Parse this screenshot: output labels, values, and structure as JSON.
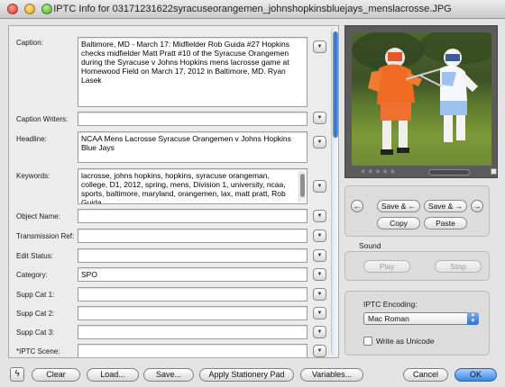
{
  "window": {
    "title": "IPTC Info for 03171231622syracuseorangemen_johnshopkinsbluejays_menslacrosse.JPG"
  },
  "fields": {
    "caption": {
      "label": "Caption:",
      "value": "Baltimore, MD - March 17: Midfielder Rob Guida #27 Hopkins checks midfielder Matt Pratt #10 of the Syracuse Orangemen during the Syracuse v Johns Hopkins mens lacrosse game at  Homewood Field on March 17, 2012 in Baltimore, MD. Ryan Lasek"
    },
    "caption_writers": {
      "label": "Caption Writers:",
      "value": ""
    },
    "headline": {
      "label": "Headline:",
      "value": "NCAA Mens Lacrosse Syracuse Orangemen v Johns Hopkins Blue Jays"
    },
    "keywords": {
      "label": "Keywords:",
      "value": "lacrosse, johns hopkins, hopkins, syracuse orangeman, college, D1, 2012, spring, mens, Division 1, university, ncaa, sports, baltimore, maryland, orangemen, lax, matt pratt, Rob Guida"
    },
    "object_name": {
      "label": "Object Name:",
      "value": ""
    },
    "transmission_ref": {
      "label": "Transmission Ref:",
      "value": ""
    },
    "edit_status": {
      "label": "Edit Status:",
      "value": ""
    },
    "category": {
      "label": "Category:",
      "value": "SPO"
    },
    "supp_cat_1": {
      "label": "Supp Cat 1:",
      "value": ""
    },
    "supp_cat_2": {
      "label": "Supp Cat 2:",
      "value": ""
    },
    "supp_cat_3": {
      "label": "Supp Cat 3:",
      "value": ""
    },
    "iptc_scene": {
      "label": "*IPTC Scene:",
      "value": ""
    }
  },
  "preview": {
    "stars": "★★★★★"
  },
  "navigation": {
    "save_prev": "Save & ←",
    "save_next": "Save & →",
    "copy": "Copy",
    "paste": "Paste"
  },
  "sound": {
    "label": "Sound",
    "play": "Play",
    "stop": "Stop"
  },
  "encoding": {
    "label": "IPTC Encoding:",
    "selected": "Mac Roman",
    "unicode_label": "Write as Unicode",
    "unicode_checked": false
  },
  "bottom": {
    "clear": "Clear",
    "load": "Load...",
    "save": "Save...",
    "apply_stationery": "Apply Stationery Pad",
    "variables": "Variables...",
    "cancel": "Cancel",
    "ok": "OK"
  },
  "icons": {
    "menu": "chevron-down-icon",
    "prev": "arrow-left-circle-icon",
    "next": "arrow-right-circle-icon",
    "bolt": "lightning-bolt-icon",
    "popup": "updown-chevron-icon"
  },
  "colors": {
    "accent": "#3c86e0",
    "panel": "#ececec",
    "window": "#e4e4e4"
  }
}
